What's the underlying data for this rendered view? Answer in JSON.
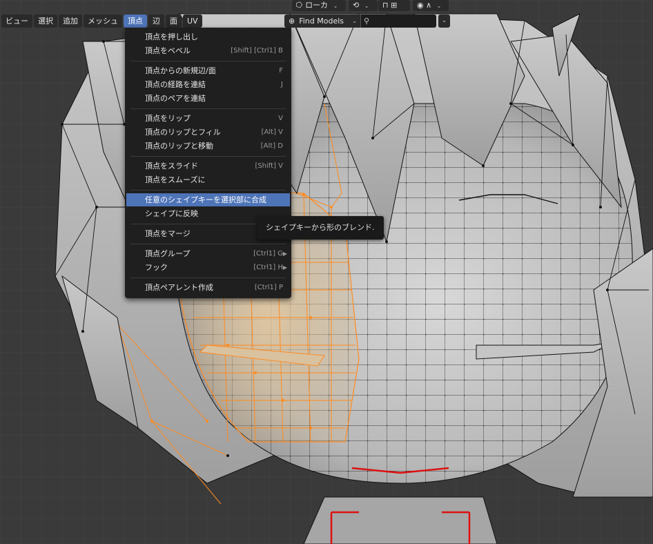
{
  "header": {
    "transform_orientation": "ローカ",
    "chevron": "⌄"
  },
  "menubar": {
    "items": [
      "ビュー",
      "選択",
      "追加",
      "メッシュ",
      "頂点",
      "辺",
      "面",
      "UV"
    ],
    "active_index": 4
  },
  "find_models": {
    "label": "Find Models",
    "search_value": ""
  },
  "vertex_menu": {
    "items": [
      {
        "label": "頂点を押し出し",
        "shortcut": ""
      },
      {
        "label": "頂点をベベル",
        "shortcut": "[Shift] [Ctrl1] B"
      },
      {
        "label": "頂点からの新規辺/面",
        "shortcut": "F"
      },
      {
        "label": "頂点の経路を連結",
        "shortcut": "J"
      },
      {
        "label": "頂点のペアを連結",
        "shortcut": ""
      },
      {
        "label": "頂点をリップ",
        "shortcut": "V"
      },
      {
        "label": "頂点のリップとフィル",
        "shortcut": "[Alt] V"
      },
      {
        "label": "頂点のリップと移動",
        "shortcut": "[Alt] D"
      },
      {
        "label": "頂点をスライド",
        "shortcut": "[Shift] V"
      },
      {
        "label": "頂点をスムーズに",
        "shortcut": ""
      },
      {
        "label": "任意のシェイプキーを選択部に合成",
        "shortcut": ""
      },
      {
        "label": "シェイプに反映",
        "shortcut": ""
      },
      {
        "label": "頂点をマージ",
        "shortcut": ""
      },
      {
        "label": "頂点グループ",
        "shortcut": "[Ctrl1] G"
      },
      {
        "label": "フック",
        "shortcut": "[Ctrl1] H"
      },
      {
        "label": "頂点ペアレント作成",
        "shortcut": "[Ctrl1] P"
      }
    ],
    "highlighted_index": 10,
    "submenu_arrow": "▶"
  },
  "tooltip": {
    "text": "シェイプキーから形のブレンド."
  },
  "colors": {
    "viewport_bg": "#3a3a3a",
    "menu_bg": "#1f1f1f",
    "accent": "#4e74b8",
    "selection": "#ff8a1e",
    "mesh": "#bdbdbd"
  }
}
